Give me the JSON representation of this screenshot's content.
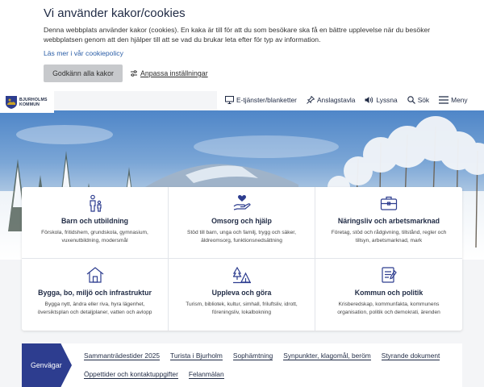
{
  "cookie": {
    "title": "Vi använder kakor/cookies",
    "text": "Denna webbplats använder kakor (cookies). En kaka är till för att du som besökare ska få en bättre upplevelse när du besöker webbplatsen genom att den hjälper till att se vad du brukar leta efter för typ av information.",
    "policy_link": "Läs mer i vår cookiepolicy",
    "accept_label": "Godkänn alla kakor",
    "customize_label": "Anpassa inställningar"
  },
  "logo": {
    "line1": "BJURHOLMS",
    "line2": "KOMMUN"
  },
  "nav": [
    {
      "label": "E-tjänster/blanketter",
      "icon": "monitor-icon"
    },
    {
      "label": "Anslagstavla",
      "icon": "pin-icon"
    },
    {
      "label": "Lyssna",
      "icon": "speaker-icon"
    },
    {
      "label": "Sök",
      "icon": "search-icon"
    },
    {
      "label": "Meny",
      "icon": "menu-icon"
    }
  ],
  "categories": [
    {
      "title": "Barn och utbildning",
      "desc": "Förskola, fritidshem, grundskola, gymnasium, vuxenutbildning, modersmål",
      "icon": "child-adult-icon"
    },
    {
      "title": "Omsorg och hjälp",
      "desc": "Stöd till barn, unga och familj, trygg och säker, äldreomsorg, funktionsnedsättning",
      "icon": "heart-hand-icon"
    },
    {
      "title": "Näringsliv och arbetsmarknad",
      "desc": "Företag, stöd och rådgivning, tillstånd, regler och tillsyn, arbetsmarknad, mark",
      "icon": "briefcase-icon"
    },
    {
      "title": "Bygga, bo, miljö och infrastruktur",
      "desc": "Bygga nytt, ändra eller riva, hyra lägenhet, översiktsplan och detaljplaner, vatten och avlopp",
      "icon": "house-icon"
    },
    {
      "title": "Uppleva och göra",
      "desc": "Turism, bibliotek, kultur, simhall, friluftsliv, idrott, föreningsliv, lokalbokning",
      "icon": "tent-tree-icon"
    },
    {
      "title": "Kommun och politik",
      "desc": "Krisberedskap, kommunfakta, kommunens organisation, politik och demokrati, ärenden",
      "icon": "document-icon"
    }
  ],
  "shortcuts": {
    "label": "Genvägar",
    "links": [
      "Sammanträdestider 2025",
      "Turista i Bjurholm",
      "Sophämtning",
      "Synpunkter, klagomål, beröm",
      "Styrande dokument",
      "Öppettider och kontaktuppgifter",
      "Felanmälan"
    ]
  },
  "colors": {
    "primary": "#2d3d8f",
    "text": "#1f2a44",
    "link": "#2b5ea7"
  }
}
